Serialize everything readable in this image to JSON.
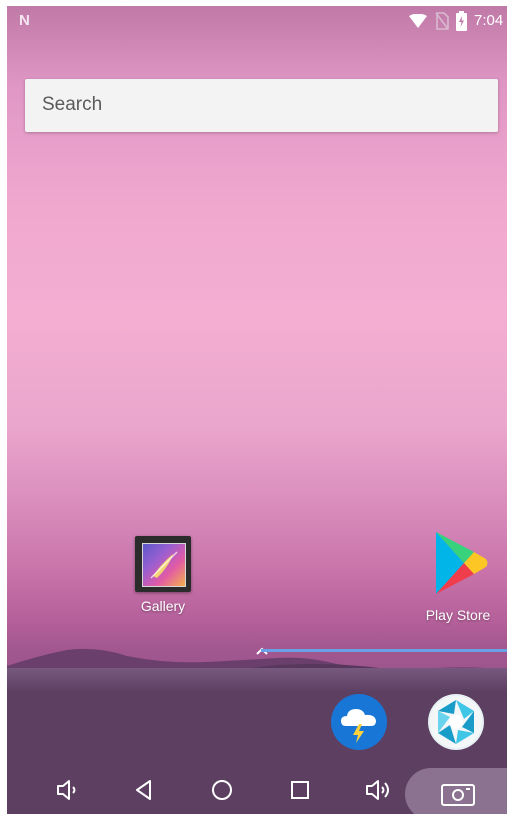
{
  "status_bar": {
    "logo": "N",
    "time": "7:04",
    "icons": [
      "wifi-icon",
      "no-sim-icon",
      "battery-charging-icon"
    ]
  },
  "search": {
    "placeholder": "Search"
  },
  "home_apps": [
    {
      "label": "Gallery",
      "icon": "gallery-icon"
    },
    {
      "label": "Play Store",
      "icon": "play-store-icon"
    }
  ],
  "dock_apps": [
    {
      "icon": "weather-cloud-bolt-icon"
    },
    {
      "icon": "camera-aperture-icon"
    }
  ],
  "nav_bar": {
    "buttons": [
      "volume-down-icon",
      "back-icon",
      "home-icon",
      "recents-icon",
      "volume-up-icon",
      "screenshot-icon"
    ]
  },
  "colors": {
    "wallpaper_top": "#c07aa8",
    "wallpaper_mid": "#f4aed2",
    "dock": "#5d3f62",
    "accent_line": "#6aa0e6",
    "weather_icon_bg": "#1877d6"
  }
}
